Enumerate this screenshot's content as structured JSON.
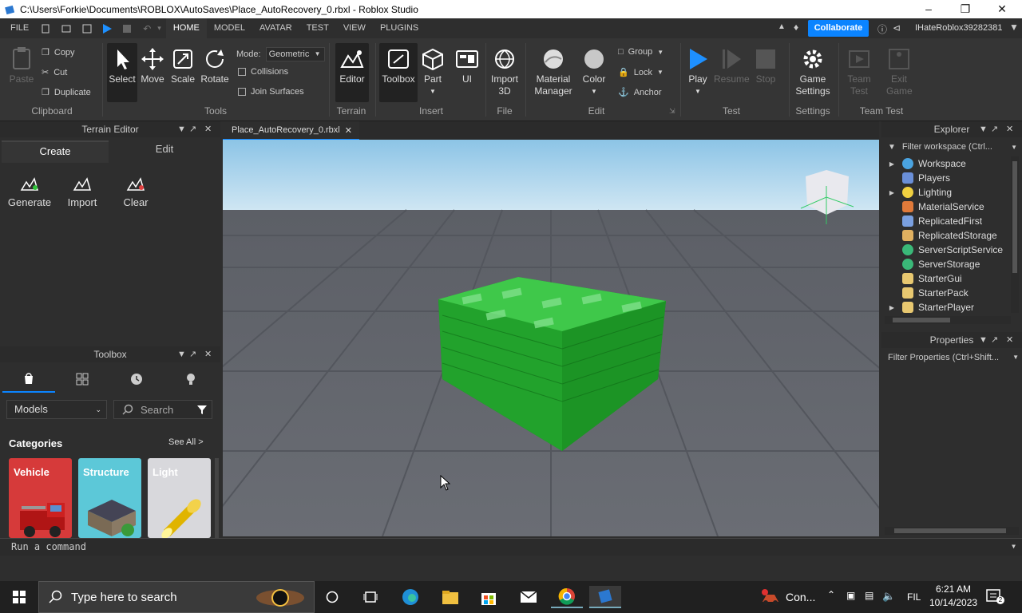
{
  "window": {
    "title": "C:\\Users\\Forkie\\Documents\\ROBLOX\\AutoSaves\\Place_AutoRecovery_0.rbxl - Roblox Studio"
  },
  "menu": {
    "file": "FILE",
    "tabs": [
      "HOME",
      "MODEL",
      "AVATAR",
      "TEST",
      "VIEW",
      "PLUGINS"
    ],
    "collaborate": "Collaborate",
    "username": "IHateRoblox39282381"
  },
  "ribbon": {
    "clipboard": {
      "paste": "Paste",
      "copy": "Copy",
      "cut": "Cut",
      "duplicate": "Duplicate",
      "group": "Clipboard"
    },
    "tools": {
      "select": "Select",
      "move": "Move",
      "scale": "Scale",
      "rotate": "Rotate",
      "mode_label": "Mode:",
      "mode_value": "Geometric",
      "collisions": "Collisions",
      "join_surfaces": "Join Surfaces",
      "group": "Tools"
    },
    "terrain": {
      "editor": "Editor",
      "group": "Terrain"
    },
    "insert": {
      "toolbox": "Toolbox",
      "part": "Part",
      "ui": "UI",
      "group": "Insert"
    },
    "file": {
      "import3d": "Import 3D",
      "group": "File"
    },
    "edit": {
      "material": "Material Manager",
      "color": "Color",
      "group_btn": "Group",
      "lock": "Lock",
      "anchor": "Anchor",
      "group": "Edit"
    },
    "test": {
      "play": "Play",
      "resume": "Resume",
      "stop": "Stop",
      "group": "Test"
    },
    "settings": {
      "game": "Game Settings",
      "group": "Settings"
    },
    "teamtest": {
      "team": "Team Test",
      "exit": "Exit Game",
      "group": "Team Test"
    }
  },
  "terrain_editor": {
    "title": "Terrain Editor",
    "tab_create": "Create",
    "tab_edit": "Edit",
    "generate": "Generate",
    "import": "Import",
    "clear": "Clear"
  },
  "toolbox": {
    "title": "Toolbox",
    "dropdown": "Models",
    "search_placeholder": "Search",
    "categories": "Categories",
    "see_all": "See All >",
    "cards": [
      "Vehicle",
      "Structure",
      "Light"
    ]
  },
  "editor_tab": "Place_AutoRecovery_0.rbxl",
  "explorer": {
    "title": "Explorer",
    "filter": "Filter workspace (Ctrl...",
    "items": [
      "Workspace",
      "Players",
      "Lighting",
      "MaterialService",
      "ReplicatedFirst",
      "ReplicatedStorage",
      "ServerScriptService",
      "ServerStorage",
      "StarterGui",
      "StarterPack",
      "StarterPlayer"
    ]
  },
  "properties": {
    "title": "Properties",
    "filter": "Filter Properties (Ctrl+Shift..."
  },
  "command_bar": {
    "placeholder": "Run a command"
  },
  "taskbar": {
    "search": "Type here to search",
    "notif": "Con...",
    "lang": "FIL",
    "time": "6:21 AM",
    "date": "10/14/2023"
  },
  "colors": {
    "accent": "#0b84ff",
    "play": "#1e90ff",
    "cash": "#2fc43a"
  }
}
